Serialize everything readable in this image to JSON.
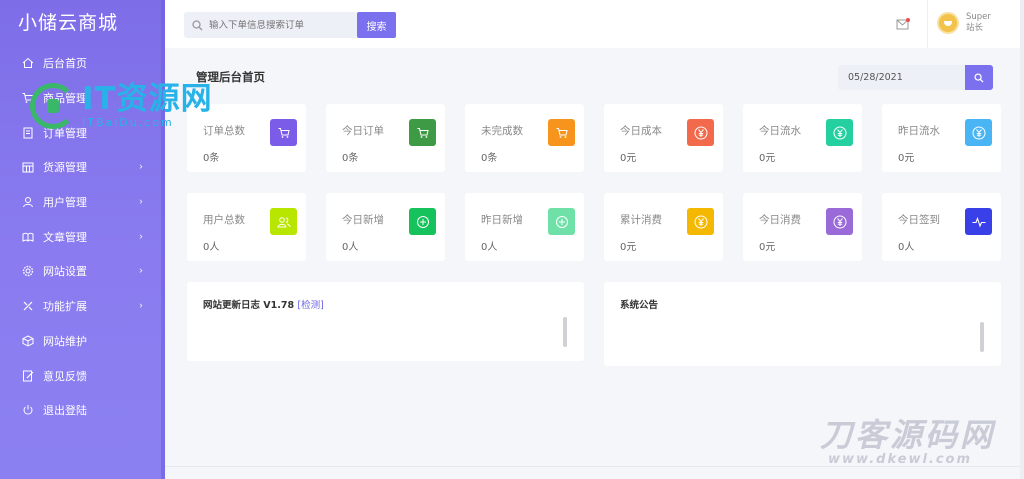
{
  "brand": "小储云商城",
  "sidebar": {
    "items": [
      {
        "label": "后台首页",
        "icon": "home-icon",
        "has_arrow": false
      },
      {
        "label": "商品管理",
        "icon": "cart-icon",
        "has_arrow": false
      },
      {
        "label": "订单管理",
        "icon": "list-icon",
        "has_arrow": false
      },
      {
        "label": "货源管理",
        "icon": "grid-icon",
        "has_arrow": true
      },
      {
        "label": "用户管理",
        "icon": "user-icon",
        "has_arrow": true
      },
      {
        "label": "文章管理",
        "icon": "book-icon",
        "has_arrow": true
      },
      {
        "label": "网站设置",
        "icon": "gear-icon",
        "has_arrow": true
      },
      {
        "label": "功能扩展",
        "icon": "tools-icon",
        "has_arrow": true
      },
      {
        "label": "网站维护",
        "icon": "cube-icon",
        "has_arrow": false
      },
      {
        "label": "意见反馈",
        "icon": "feedback-icon",
        "has_arrow": false
      },
      {
        "label": "退出登陆",
        "icon": "power-icon",
        "has_arrow": false
      }
    ]
  },
  "topbar": {
    "search_placeholder": "输入下单信息搜索订单",
    "search_button": "搜索",
    "user_name": "Super",
    "user_role": "站长"
  },
  "page": {
    "title": "管理后台首页",
    "date": "05/28/2021"
  },
  "stats": [
    {
      "label": "订单总数",
      "value": "0条",
      "color": "#7b5ce8",
      "icon": "cart-icon"
    },
    {
      "label": "今日订单",
      "value": "0条",
      "color": "#3f9a45",
      "icon": "cart-icon"
    },
    {
      "label": "未完成数",
      "value": "0条",
      "color": "#f7941d",
      "icon": "cart-icon"
    },
    {
      "label": "今日成本",
      "value": "0元",
      "color": "#f26a4b",
      "icon": "yen-icon"
    },
    {
      "label": "今日流水",
      "value": "0元",
      "color": "#24d0a0",
      "icon": "yen-icon"
    },
    {
      "label": "昨日流水",
      "value": "0元",
      "color": "#4ab5f5",
      "icon": "yen-icon"
    },
    {
      "label": "用户总数",
      "value": "0人",
      "color": "#b8e600",
      "icon": "users-icon"
    },
    {
      "label": "今日新增",
      "value": "0人",
      "color": "#15c25b",
      "icon": "plus-circle-icon"
    },
    {
      "label": "昨日新增",
      "value": "0人",
      "color": "#6ee0a8",
      "icon": "plus-circle-icon"
    },
    {
      "label": "累计消费",
      "value": "0元",
      "color": "#f5b800",
      "icon": "yen-icon"
    },
    {
      "label": "今日消费",
      "value": "0元",
      "color": "#9a6ad8",
      "icon": "yen-icon"
    },
    {
      "label": "今日签到",
      "value": "0人",
      "color": "#3a40e8",
      "icon": "pulse-icon"
    }
  ],
  "panels": {
    "changelog_title": "网站更新日志 V1.78",
    "changelog_link": "[检测]",
    "notice_title": "系统公告"
  },
  "watermarks": {
    "left_big": "IT资源网",
    "left_small": "ITBaiDu.com",
    "right_big": "刀客源码网",
    "right_small": "www.dkewl.com"
  }
}
